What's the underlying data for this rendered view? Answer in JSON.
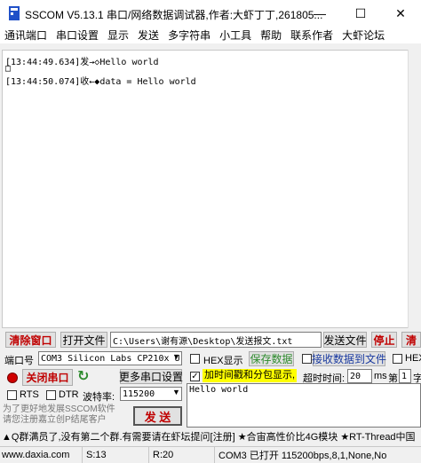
{
  "window": {
    "title": "SSCOM V5.13.1 串口/网络数据调试器,作者:大虾丁丁,261805...",
    "minimize_icon": "minimize-icon",
    "maximize_icon": "maximize-icon",
    "close_icon": "close-icon"
  },
  "menu": [
    "通讯端口",
    "串口设置",
    "显示",
    "发送",
    "多字符串",
    "小工具",
    "帮助",
    "联系作者",
    "大虾论坛"
  ],
  "log": [
    "[13:44:49.634]发→◇Hello world",
    "□",
    "[13:44:50.074]收←◆data = Hello world"
  ],
  "toolbar": {
    "clear_window": "清除窗口",
    "open_file": "打开文件",
    "file_path": "C:\\Users\\谢有源\\Desktop\\发送报文.txt",
    "send_file": "发送文件",
    "stop": "停止",
    "clear": "清"
  },
  "port": {
    "port_label": "端口号",
    "port_value": "COM3 Silicon Labs CP210x U",
    "hex_display": "HEX显示",
    "save_data": "保存数据",
    "receive_to_file": "接收数据到文件",
    "hex_send": "HEX",
    "close_port": "关闭串口",
    "multi_port_settings": "更多串口设置",
    "timestamp_label": "加时间戳和分包显示,",
    "timeout_label": "超时时间:",
    "timeout_value": "20",
    "timeout_unit": "ms",
    "page_label": "第",
    "page_value": "1",
    "page_unit": "字",
    "rts": "RTS",
    "dtr": "DTR",
    "baud_label": "波特率:",
    "baud_value": "115200",
    "send_text": "Hello world",
    "promo": "为了更好地发展SSCOM软件\n请您注册嘉立创P结尾客户",
    "send": "发 送"
  },
  "ticker": "▲Q群满员了,没有第二个群.有需要请在虾坛提问[注册] ★合宙高性价比4G模块 ★RT-Thread中国",
  "status": {
    "website": "www.daxia.com",
    "s": "S:13",
    "r": "R:20",
    "port_info": "COM3 已打开  115200bps,8,1,None,No"
  },
  "colors": {
    "accent_red": "#c00000",
    "green": "#2e8b2e",
    "highlight": "#ffff00",
    "led": "#d00000"
  }
}
